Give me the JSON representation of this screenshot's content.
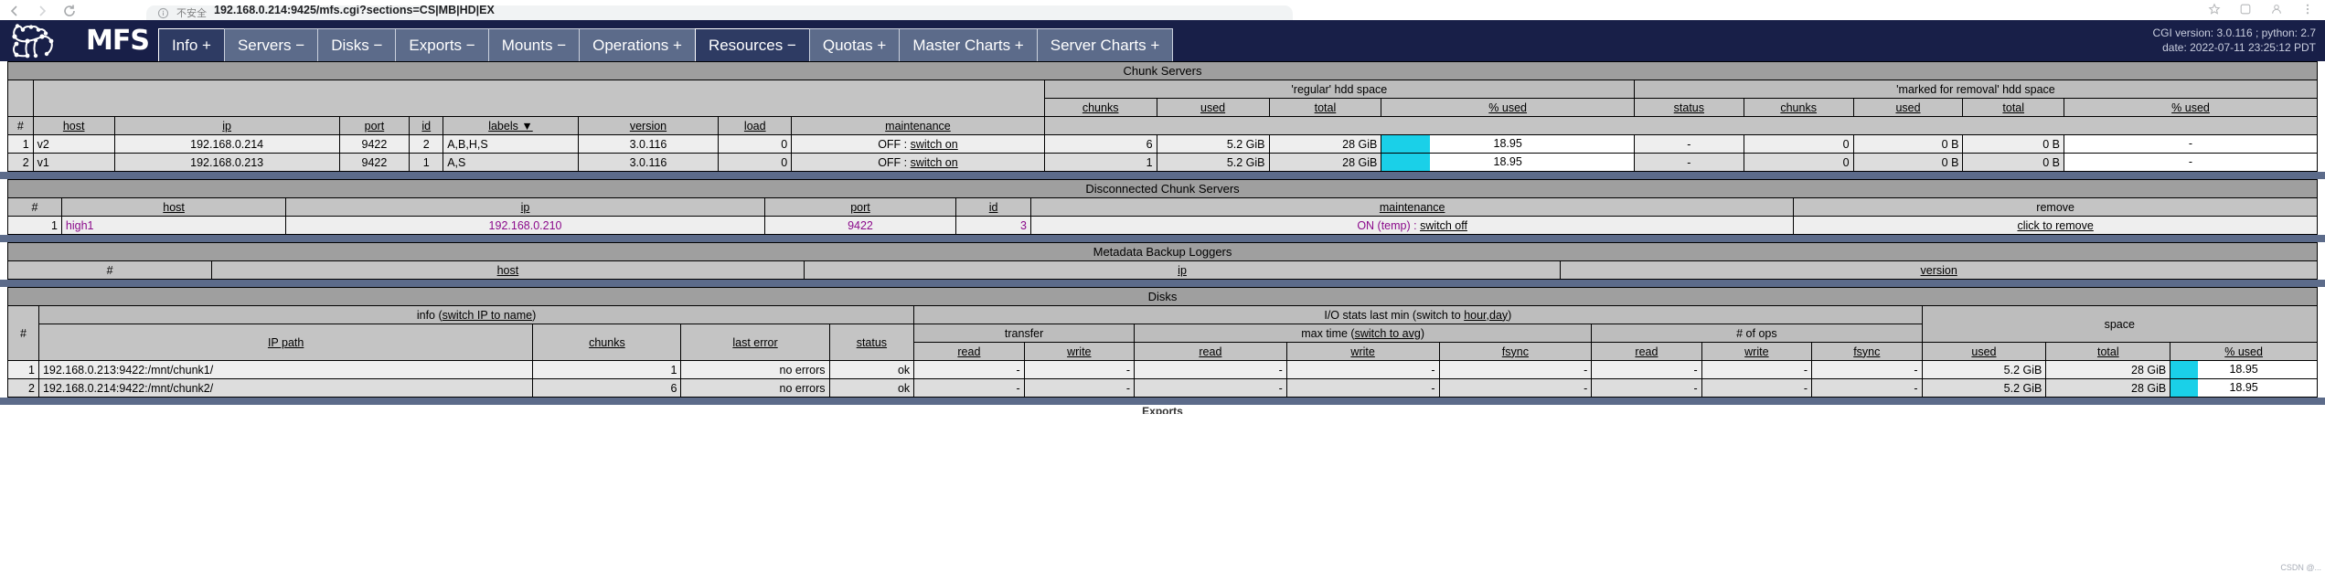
{
  "browser": {
    "url_label": "192.168.0.214:9425/mfs.cgi?sections=CS|MB|HD|EX",
    "security_label": "不安全",
    "icons": [
      "back-icon",
      "forward-icon",
      "reload-icon",
      "bookmark-icon",
      "extensions-icon",
      "profile-icon",
      "menu-icon"
    ]
  },
  "header": {
    "logo_text": "MFS",
    "nav": [
      {
        "label": "Info +",
        "active": true
      },
      {
        "label": "Servers −",
        "active": false
      },
      {
        "label": "Disks −",
        "active": false
      },
      {
        "label": "Exports −",
        "active": false
      },
      {
        "label": "Mounts −",
        "active": false
      },
      {
        "label": "Operations +",
        "active": false
      },
      {
        "label": "Resources −",
        "active": false
      },
      {
        "label": "Quotas +",
        "active": false
      },
      {
        "label": "Master Charts +",
        "active": false
      },
      {
        "label": "Server Charts +",
        "active": false
      }
    ],
    "cgi_version": "CGI version: 3.0.116 ; python: 2.7",
    "date": "date: 2022-07-11 23:25:12 PDT"
  },
  "chunk_servers": {
    "title": "Chunk Servers",
    "group_headers": {
      "regular": "'regular' hdd space",
      "removal": "'marked for removal' hdd space"
    },
    "columns": [
      "#",
      "host",
      "ip",
      "port",
      "id",
      "labels ▼",
      "version",
      "load",
      "maintenance"
    ],
    "regular_columns": [
      "chunks",
      "used",
      "total",
      "% used"
    ],
    "removal_columns": [
      "status",
      "chunks",
      "used",
      "total",
      "% used"
    ],
    "rows": [
      {
        "num": "1",
        "host": "v2",
        "ip": "192.168.0.214",
        "port": "9422",
        "id": "2",
        "labels": "A,B,H,S",
        "version": "3.0.116",
        "load": "0",
        "maintenance_state": "OFF : ",
        "maintenance_action": "switch on",
        "chunks": "6",
        "used": "5.2 GiB",
        "total": "28 GiB",
        "pct_used": "18.95",
        "rm_status": "-",
        "rm_chunks": "0",
        "rm_used": "0 B",
        "rm_total": "0 B",
        "rm_pct": "-"
      },
      {
        "num": "2",
        "host": "v1",
        "ip": "192.168.0.213",
        "port": "9422",
        "id": "1",
        "labels": "A,S",
        "version": "3.0.116",
        "load": "0",
        "maintenance_state": "OFF : ",
        "maintenance_action": "switch on",
        "chunks": "1",
        "used": "5.2 GiB",
        "total": "28 GiB",
        "pct_used": "18.95",
        "rm_status": "-",
        "rm_chunks": "0",
        "rm_used": "0 B",
        "rm_total": "0 B",
        "rm_pct": "-"
      }
    ]
  },
  "disconnected": {
    "title": "Disconnected Chunk Servers",
    "columns": [
      "#",
      "host",
      "ip",
      "port",
      "id",
      "maintenance",
      "remove"
    ],
    "rows": [
      {
        "num": "1",
        "host": "high1",
        "ip": "192.168.0.210",
        "port": "9422",
        "id": "3",
        "maintenance_state": "ON (temp) : ",
        "maintenance_action": "switch off",
        "remove": "click to remove"
      }
    ]
  },
  "metadata_backup_loggers": {
    "title": "Metadata Backup Loggers",
    "columns": [
      "#",
      "host",
      "ip",
      "version"
    ],
    "rows": []
  },
  "disks": {
    "title": "Disks",
    "info_label": "info (",
    "info_link": "switch IP to name",
    "info_label_end": ")",
    "iostats_label": "I/O stats last min (switch to ",
    "iostats_link": "hour,day",
    "iostats_label_end": ")",
    "group_transfer": "transfer",
    "group_maxtime_pre": "max time (",
    "group_maxtime_link": "switch to avg",
    "group_maxtime_post": ")",
    "group_ops": "# of ops",
    "group_space": "space",
    "columns": [
      "#",
      "IP path",
      "chunks",
      "last error",
      "status",
      "read",
      "write",
      "read",
      "write",
      "fsync",
      "read",
      "write",
      "fsync",
      "used",
      "total",
      "% used"
    ],
    "rows": [
      {
        "num": "1",
        "path": "192.168.0.213:9422:/mnt/chunk1/",
        "chunks": "1",
        "last_error": "no errors",
        "status": "ok",
        "t_read": "-",
        "t_write": "-",
        "m_read": "-",
        "m_write": "-",
        "m_fsync": "-",
        "o_read": "-",
        "o_write": "-",
        "o_fsync": "-",
        "used": "5.2 GiB",
        "total": "28 GiB",
        "pct_used": "18.95"
      },
      {
        "num": "2",
        "path": "192.168.0.214:9422:/mnt/chunk2/",
        "chunks": "6",
        "last_error": "no errors",
        "status": "ok",
        "t_read": "-",
        "t_write": "-",
        "m_read": "-",
        "m_write": "-",
        "m_fsync": "-",
        "o_read": "-",
        "o_write": "-",
        "o_fsync": "-",
        "used": "5.2 GiB",
        "total": "28 GiB",
        "pct_used": "18.95"
      }
    ]
  },
  "exports": {
    "title": "Exports"
  },
  "watermark": "CSDN @...",
  "colors": {
    "header_bg": "#181f48",
    "tab_bg": "#5c6b8a",
    "tab_active_bg": "#2e3b63",
    "section_title_bg": "#9f9f9f",
    "col_header_bg": "#c4c4c4",
    "row_odd": "#eeeeee",
    "row_even": "#dddddd",
    "bar_fill": "#1ad0e8",
    "disconnected_text": "#8b0a8b"
  }
}
